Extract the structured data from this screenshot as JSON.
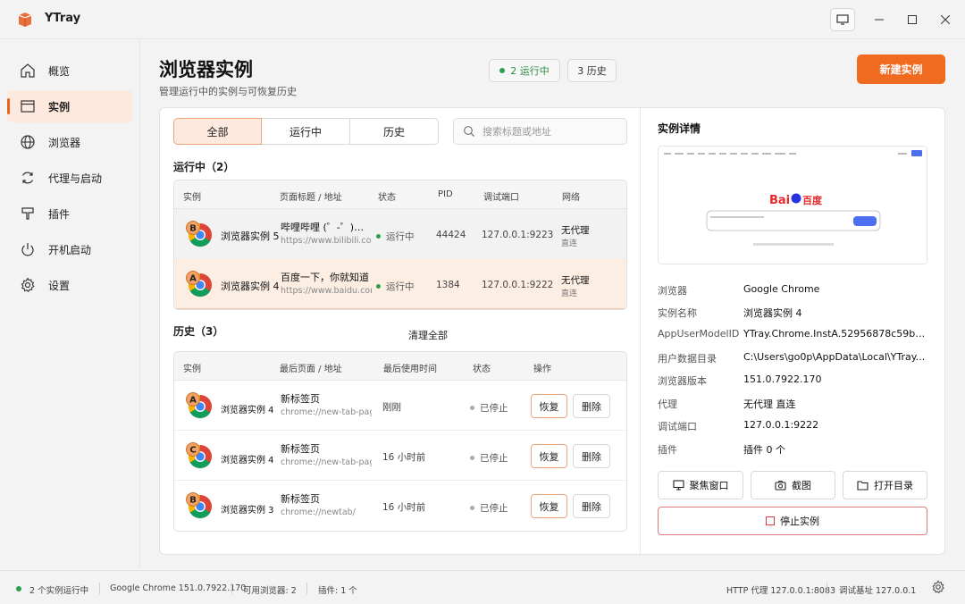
{
  "app": {
    "title": "YTray"
  },
  "sidebar": {
    "items": [
      {
        "label": "概览"
      },
      {
        "label": "实例"
      },
      {
        "label": "浏览器"
      },
      {
        "label": "代理与启动"
      },
      {
        "label": "插件"
      },
      {
        "label": "开机启动"
      },
      {
        "label": "设置"
      }
    ]
  },
  "header": {
    "title": "浏览器实例",
    "subtitle": "管理运行中的实例与可恢复历史",
    "running_badge": "2 运行中",
    "history_badge": "3 历史",
    "new_button": "新建实例"
  },
  "filters": {
    "tabs": [
      "全部",
      "运行中",
      "历史"
    ],
    "search_placeholder": "搜索标题或地址"
  },
  "running": {
    "title": "运行中（2）",
    "columns": [
      "实例",
      "页面标题 / 地址",
      "状态",
      "PID",
      "调试端口",
      "网络"
    ],
    "rows": [
      {
        "badge": "B",
        "name": "浏览器实例 5",
        "page_title": "哔哩哔哩 (゜-゜)つロ 干杯~-bilibili",
        "url": "https://www.bilibili.com/",
        "status": "运行中",
        "pid": "44424",
        "port": "127.0.0.1:9223",
        "net": "无代理",
        "net_sub": "直连"
      },
      {
        "badge": "A",
        "name": "浏览器实例 4",
        "page_title": "百度一下，你就知道",
        "url": "https://www.baidu.com/",
        "status": "运行中",
        "pid": "1384",
        "port": "127.0.0.1:9222",
        "net": "无代理",
        "net_sub": "直连"
      }
    ]
  },
  "history": {
    "title": "历史（3）",
    "clear_all": "清理全部",
    "columns": [
      "实例",
      "最后页面 / 地址",
      "最后使用时间",
      "状态",
      "操作"
    ],
    "rows": [
      {
        "badge": "A",
        "name": "浏览器实例 4",
        "page_title": "新标签页",
        "url": "chrome://new-tab-page/",
        "time": "刚刚",
        "status": "已停止",
        "restore": "恢复",
        "delete": "删除"
      },
      {
        "badge": "C",
        "name": "浏览器实例 4",
        "page_title": "新标签页",
        "url": "chrome://new-tab-page/",
        "time": "16 小时前",
        "status": "已停止",
        "restore": "恢复",
        "delete": "删除"
      },
      {
        "badge": "B",
        "name": "浏览器实例 3",
        "page_title": "新标签页",
        "url": "chrome://newtab/",
        "time": "16 小时前",
        "status": "已停止",
        "restore": "恢复",
        "delete": "删除"
      }
    ]
  },
  "details": {
    "title": "实例详情",
    "preview_logo": "百度",
    "fields": [
      {
        "label": "浏览器",
        "value": "Google Chrome"
      },
      {
        "label": "实例名称",
        "value": "浏览器实例 4"
      },
      {
        "label": "AppUserModelID",
        "value": "YTray.Chrome.InstA.52956878c59b4a..."
      },
      {
        "label": "用户数据目录",
        "value": "C:\\Users\\go0p\\AppData\\Local\\YTray..."
      },
      {
        "label": "浏览器版本",
        "value": "151.0.7922.170"
      },
      {
        "label": "代理",
        "value": "无代理 直连"
      },
      {
        "label": "调试端口",
        "value": "127.0.0.1:9222"
      },
      {
        "label": "插件",
        "value": "插件 0 个"
      }
    ],
    "focus_button": "聚焦窗口",
    "screenshot_button": "截图",
    "open_dir_button": "打开目录",
    "stop_button": "停止实例"
  },
  "statusbar": {
    "running": "2 个实例运行中",
    "browser": "Google Chrome 151.0.7922.170",
    "available": "可用浏览器: 2",
    "plugins": "插件: 1 个",
    "http_proxy": "HTTP 代理 127.0.0.1:8083",
    "debug_base": "调试基址 127.0.0.1"
  },
  "colors": {
    "accent": "#f06a20",
    "accent_light": "#fde9dd",
    "running_green": "#2e9e4f",
    "stop_red": "#d83b3b"
  }
}
